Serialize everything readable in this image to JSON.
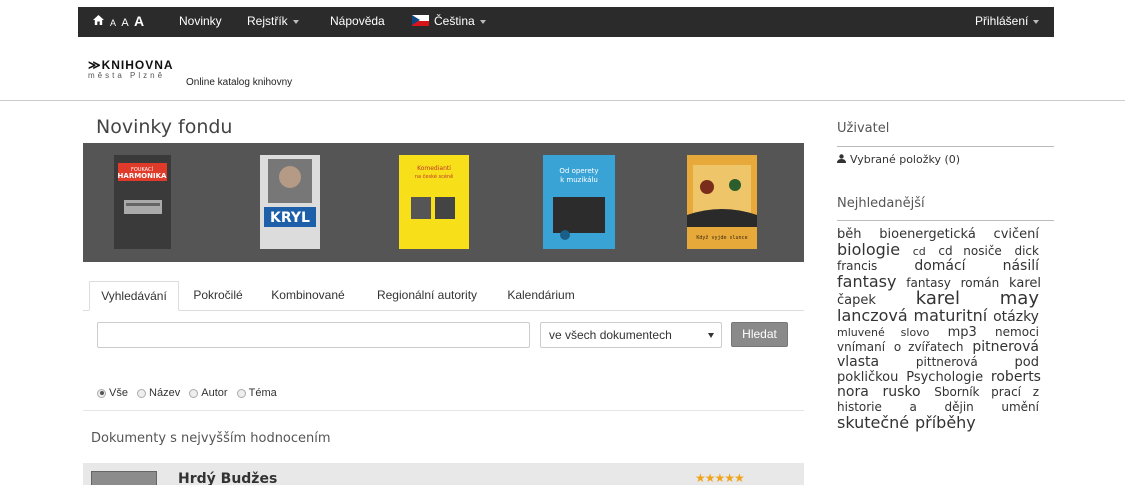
{
  "topnav": {
    "font_size": [
      "A",
      "A",
      "A"
    ],
    "items": [
      "Novinky",
      "Rejstřík",
      "Nápověda",
      "Čeština"
    ],
    "login": "Přihlášení"
  },
  "header": {
    "logo_main": "KNIHOVNA",
    "logo_sub": "města Plzně",
    "subtitle": "Online katalog knihovny"
  },
  "main": {
    "title": "Novinky fondu",
    "covers": [
      {
        "title": "FOUKACÍ HARMONIKA",
        "bg": "#3a3a3a",
        "accent": "#e03a2a"
      },
      {
        "title": "KRYL",
        "bg": "#dcdcdc",
        "accent": "#1d5fa8"
      },
      {
        "title": "Komedianti na české scéně",
        "bg": "#f7e01a",
        "accent": "#c0392b"
      },
      {
        "title": "Od operety k muzikálu",
        "bg": "#3aa3d6",
        "accent": "#ffffff"
      },
      {
        "title": "Když vyjde slunce",
        "bg": "#e6a93a",
        "accent": "#7a2d1a"
      }
    ],
    "tabs": [
      "Vyhledávání",
      "Pokročilé",
      "Kombinované",
      "Regionální autority",
      "Kalendárium"
    ],
    "search": {
      "value": "",
      "scope": "ve všech dokumentech",
      "button": "Hledat"
    },
    "radios": [
      {
        "label": "Vše",
        "checked": true
      },
      {
        "label": "Název",
        "checked": false
      },
      {
        "label": "Autor",
        "checked": false
      },
      {
        "label": "Téma",
        "checked": false
      }
    ],
    "section_title": "Dokumenty s nejvyšším hodnocením",
    "top_result": {
      "title": "Hrdý Budžes",
      "stars": "★★★★★",
      "rating": 5
    }
  },
  "sidebar": {
    "user_title": "Uživatel",
    "selected_items": "Vybrané položky (0)",
    "popular_title": "Nejhledanější",
    "tags": [
      {
        "text": "běh",
        "size": 13
      },
      {
        "text": "bioenergetická",
        "size": 13
      },
      {
        "text": "cvičení",
        "size": 13
      },
      {
        "text": "biologie",
        "size": 16
      },
      {
        "text": "cd",
        "size": 11
      },
      {
        "text": "cd nosiče",
        "size": 12
      },
      {
        "text": "dick",
        "size": 12
      },
      {
        "text": "francis",
        "size": 12
      },
      {
        "text": "domácí",
        "size": 14
      },
      {
        "text": "násilí",
        "size": 14
      },
      {
        "text": "fantasy",
        "size": 16
      },
      {
        "text": "fantasy",
        "size": 12
      },
      {
        "text": "román",
        "size": 12
      },
      {
        "text": "karel čapek",
        "size": 13
      },
      {
        "text": "karel may",
        "size": 18
      },
      {
        "text": "lanczová",
        "size": 16
      },
      {
        "text": "maturitní",
        "size": 16
      },
      {
        "text": "otázky",
        "size": 14
      },
      {
        "text": "mluvené slovo",
        "size": 11
      },
      {
        "text": "mp3",
        "size": 13
      },
      {
        "text": "nemoci",
        "size": 12
      },
      {
        "text": "vnímaní",
        "size": 12
      },
      {
        "text": "o zvířatech",
        "size": 12
      },
      {
        "text": "pitnerová",
        "size": 14
      },
      {
        "text": "vlasta",
        "size": 14
      },
      {
        "text": "pittnerová",
        "size": 12
      },
      {
        "text": "pod",
        "size": 13
      },
      {
        "text": "pokličkou",
        "size": 13
      },
      {
        "text": "Psychologie",
        "size": 13
      },
      {
        "text": "roberts nora",
        "size": 14
      },
      {
        "text": "rusko",
        "size": 14
      },
      {
        "text": "Sborník prací z",
        "size": 12
      },
      {
        "text": "historie a dějin umění",
        "size": 12
      },
      {
        "text": "skutečné",
        "size": 16
      },
      {
        "text": "příběhy",
        "size": 16
      }
    ]
  },
  "colors": {
    "nav_bg": "#2b2b2b",
    "carousel_bg": "#555555",
    "stars": "#f0a41c"
  }
}
